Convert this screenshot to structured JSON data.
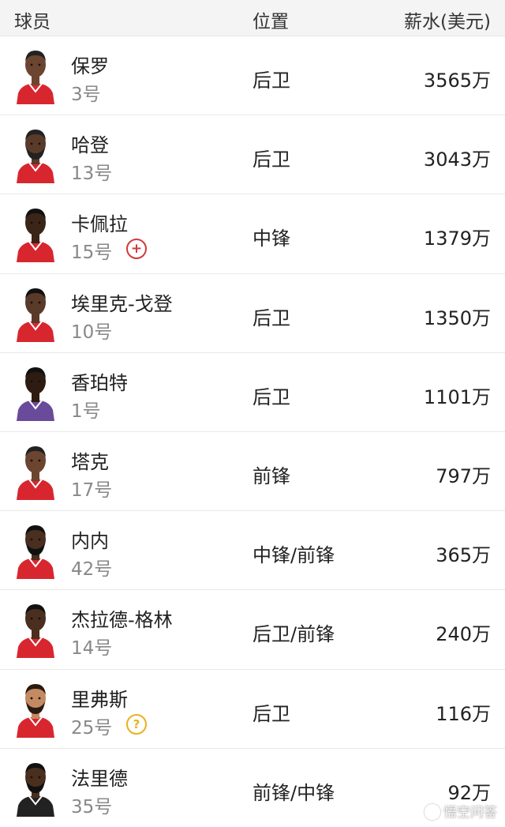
{
  "header": {
    "player": "球员",
    "position": "位置",
    "salary": "薪水(美元)"
  },
  "colors": {
    "rockets_jersey": "#d8262f",
    "kings_jersey": "#6a4a9a",
    "nets_jersey": "#222222",
    "injury_badge": "#d23a3a",
    "unknown_badge": "#e8b21c"
  },
  "players": [
    {
      "name": "保罗",
      "number": "3号",
      "position": "后卫",
      "salary": "3565万"
    },
    {
      "name": "哈登",
      "number": "13号",
      "position": "后卫",
      "salary": "3043万"
    },
    {
      "name": "卡佩拉",
      "number": "15号",
      "position": "中锋",
      "salary": "1379万",
      "badge": "injury-icon",
      "badge_glyph": "+"
    },
    {
      "name": "埃里克-戈登",
      "number": "10号",
      "position": "后卫",
      "salary": "1350万"
    },
    {
      "name": "香珀特",
      "number": "1号",
      "position": "后卫",
      "salary": "1101万"
    },
    {
      "name": "塔克",
      "number": "17号",
      "position": "前锋",
      "salary": "797万"
    },
    {
      "name": "内内",
      "number": "42号",
      "position": "中锋/前锋",
      "salary": "365万"
    },
    {
      "name": "杰拉德-格林",
      "number": "14号",
      "position": "后卫/前锋",
      "salary": "240万"
    },
    {
      "name": "里弗斯",
      "number": "25号",
      "position": "后卫",
      "salary": "116万",
      "badge": "question-icon",
      "badge_glyph": "?"
    },
    {
      "name": "法里德",
      "number": "35号",
      "position": "前锋/中锋",
      "salary": "92万"
    }
  ],
  "watermark": "悟空问答"
}
